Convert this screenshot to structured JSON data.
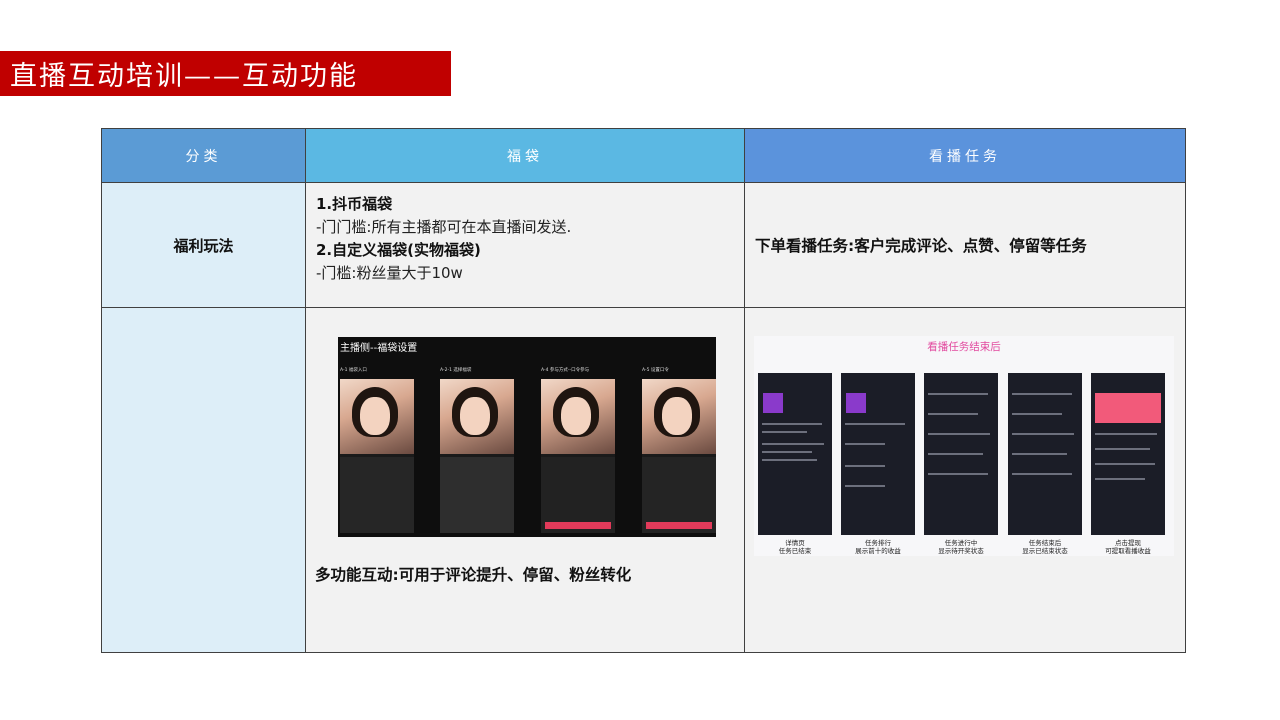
{
  "slide": {
    "title": "直播互动培训——互动功能"
  },
  "table": {
    "headers": [
      "分类",
      "福袋",
      "看播任务"
    ],
    "row1": {
      "label": "福利玩法",
      "fudai": {
        "line1": "1.抖币福袋",
        "line2": "-门门槛:所有主播都可在本直播间发送.",
        "line3": "2.自定义福袋(实物福袋)",
        "line4": "-门槛:粉丝量大于10w"
      },
      "task": "下单看播任务:客户完成评论、点赞、停留等任务"
    },
    "row2": {
      "label": "",
      "fudai_caption": "多功能互动:可用于评论提升、停留、粉丝转化"
    }
  },
  "screenshot_left": {
    "title": "主播侧--福袋设置",
    "step_labels": [
      "A-1 福袋入口",
      "A-2-1 选择福袋",
      "A-4 参与方式--口令参与",
      "A-5 设置口令"
    ]
  },
  "screenshot_right": {
    "title": "看播任务结束后",
    "captions": [
      "详情页\n任务已结束",
      "任务排行\n展示前十的收益",
      "任务进行中\n显示待开奖状态",
      "任务结束后\n显示已结束状态",
      "点击提现\n可提取看播收益"
    ]
  },
  "colors": {
    "title_bar": "#c00000",
    "header_col1": "#5b9bd5",
    "header_col2": "#5bb8e3",
    "header_col3": "#5b93dc",
    "label_bg": "#ddeef8",
    "cell_bg": "#f2f2f2"
  }
}
